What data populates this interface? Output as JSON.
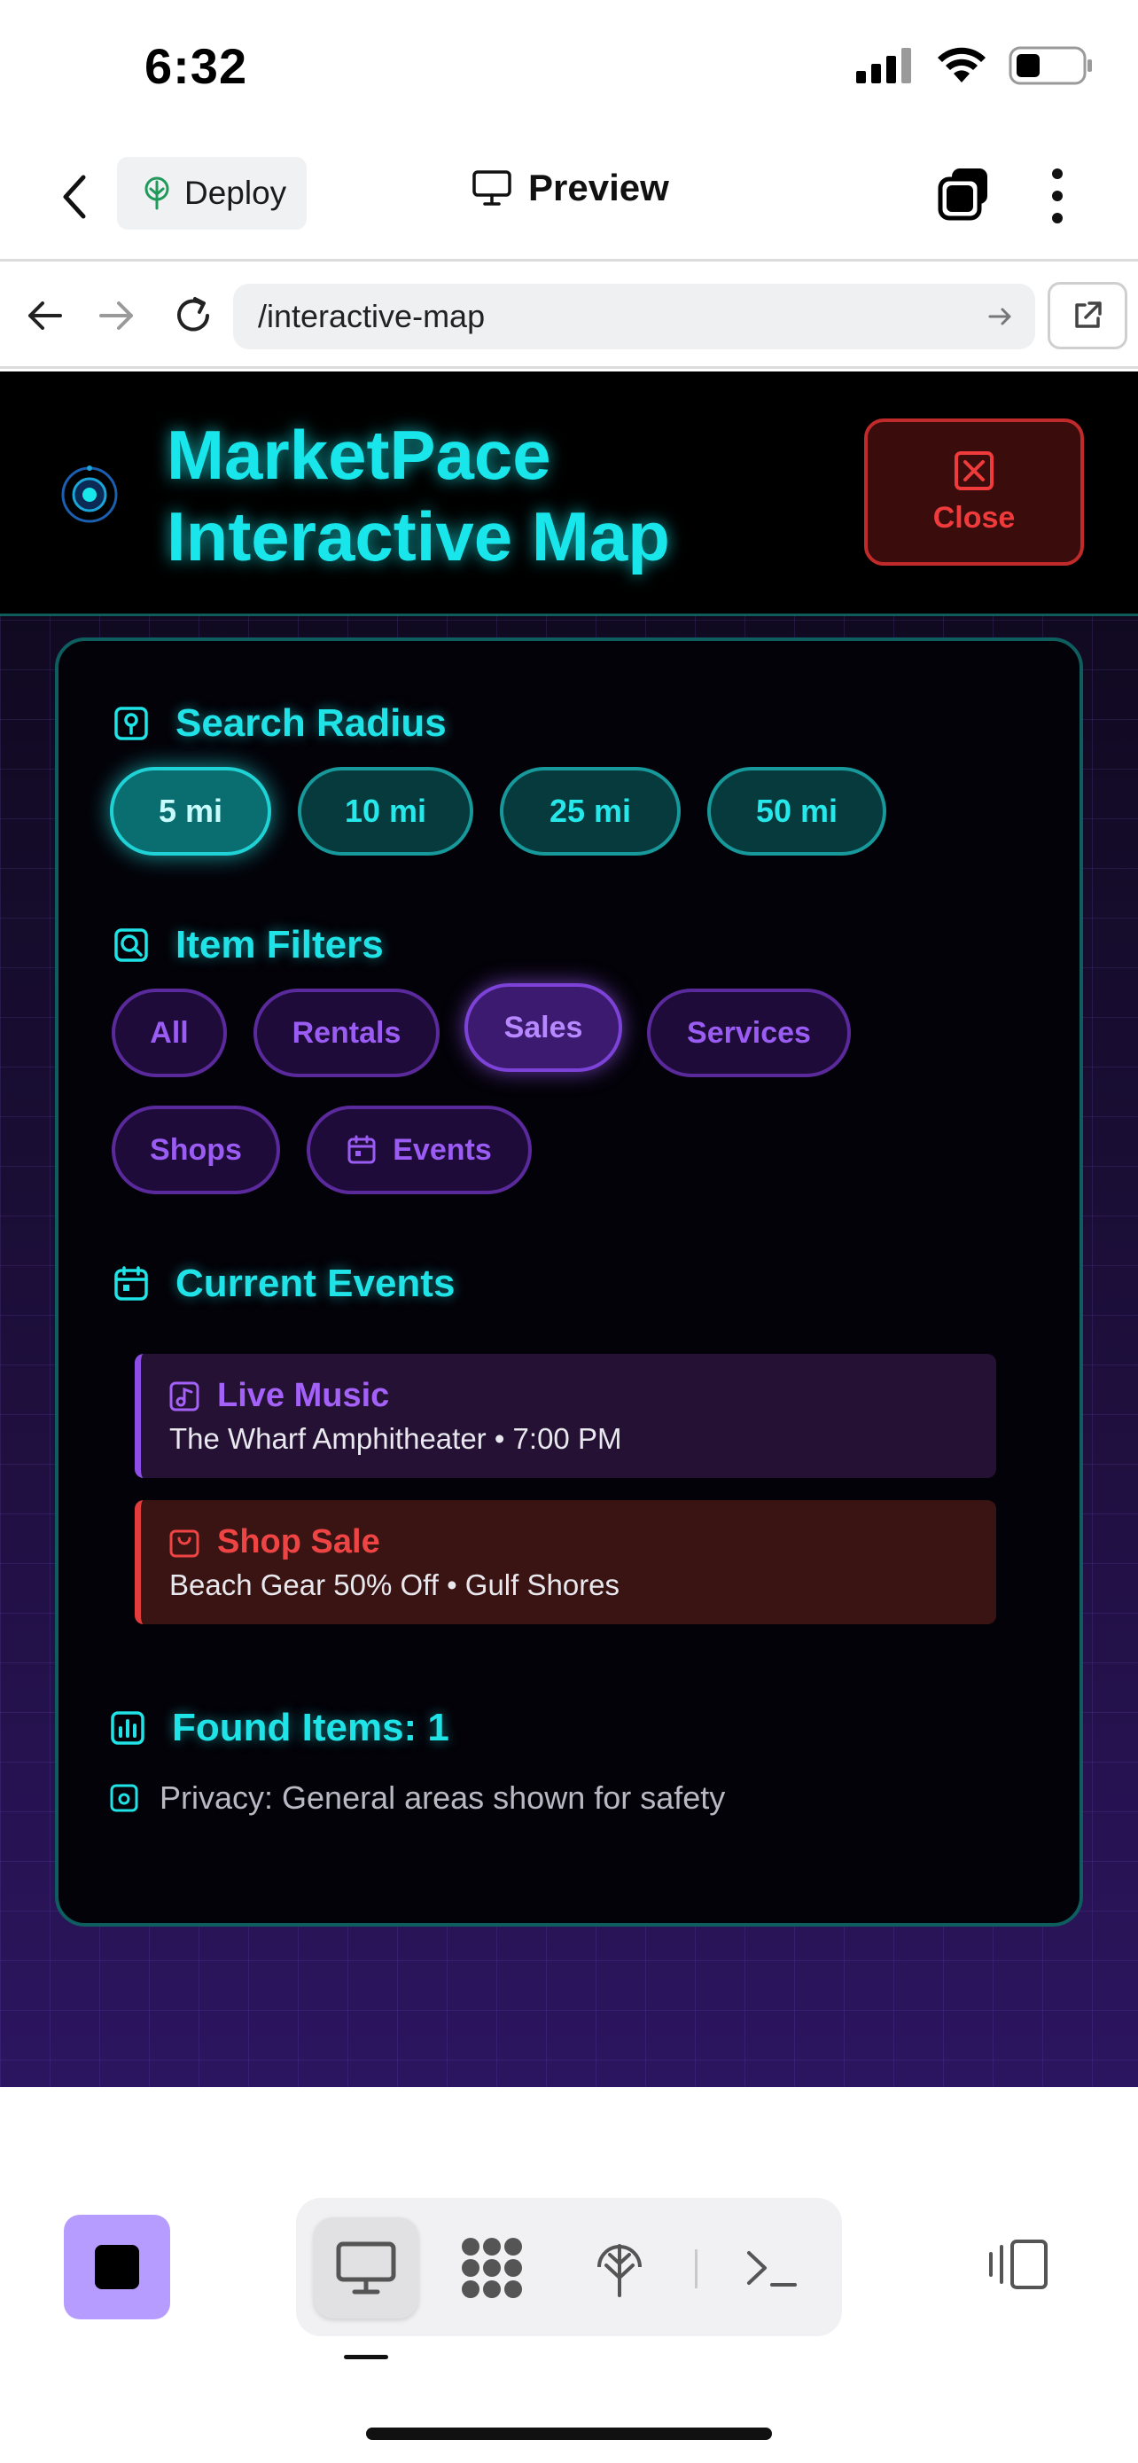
{
  "status_bar": {
    "time": "6:32",
    "icons": [
      "signal-icon",
      "wifi-icon",
      "battery-icon"
    ]
  },
  "app_bar": {
    "back_icon": "chevron-left-icon",
    "deploy_label": "Deploy",
    "preview_label": "Preview",
    "tabs_icon": "tabs-icon",
    "more_icon": "kebab-icon"
  },
  "url_bar": {
    "url": "/interactive-map",
    "icons": [
      "arrow-left-icon",
      "arrow-right-icon",
      "reload-icon",
      "go-arrow-icon",
      "external-link-icon"
    ]
  },
  "map_app": {
    "title_line1": "MarketPace",
    "title_line2": "Interactive Map",
    "close_label": "Close",
    "search_radius": {
      "title": "Search Radius",
      "options": [
        "5 mi",
        "10 mi",
        "25 mi",
        "50 mi"
      ],
      "selected": "5 mi"
    },
    "item_filters": {
      "title": "Item Filters",
      "options": [
        "All",
        "Rentals",
        "Sales",
        "Services",
        "Shops",
        "Events"
      ],
      "selected": "Sales"
    },
    "current_events": {
      "title": "Current Events",
      "events": [
        {
          "title": "Live Music",
          "detail": "The Wharf Amphitheater • 7:00 PM",
          "color": "#8d4ee8"
        },
        {
          "title": "Shop Sale",
          "detail": "Beach Gear 50% Off • Gulf Shores",
          "color": "#e23c3c"
        }
      ]
    },
    "found_items": "Found Items: 1",
    "privacy_note": "Privacy: General areas shown for safety"
  },
  "colors": {
    "accent_cyan": "#18e6ea",
    "accent_purple": "#9a5cf2",
    "danger": "#ef3b3b",
    "stop_button": "#b69cff"
  },
  "bottom_bar": {
    "stop_icon": "stop-icon",
    "segments": [
      "monitor-icon",
      "dots-grid-icon",
      "deploy-tree-icon",
      "terminal-icon"
    ],
    "active_segment": "monitor-icon",
    "side_icon": "device-switch-icon"
  }
}
